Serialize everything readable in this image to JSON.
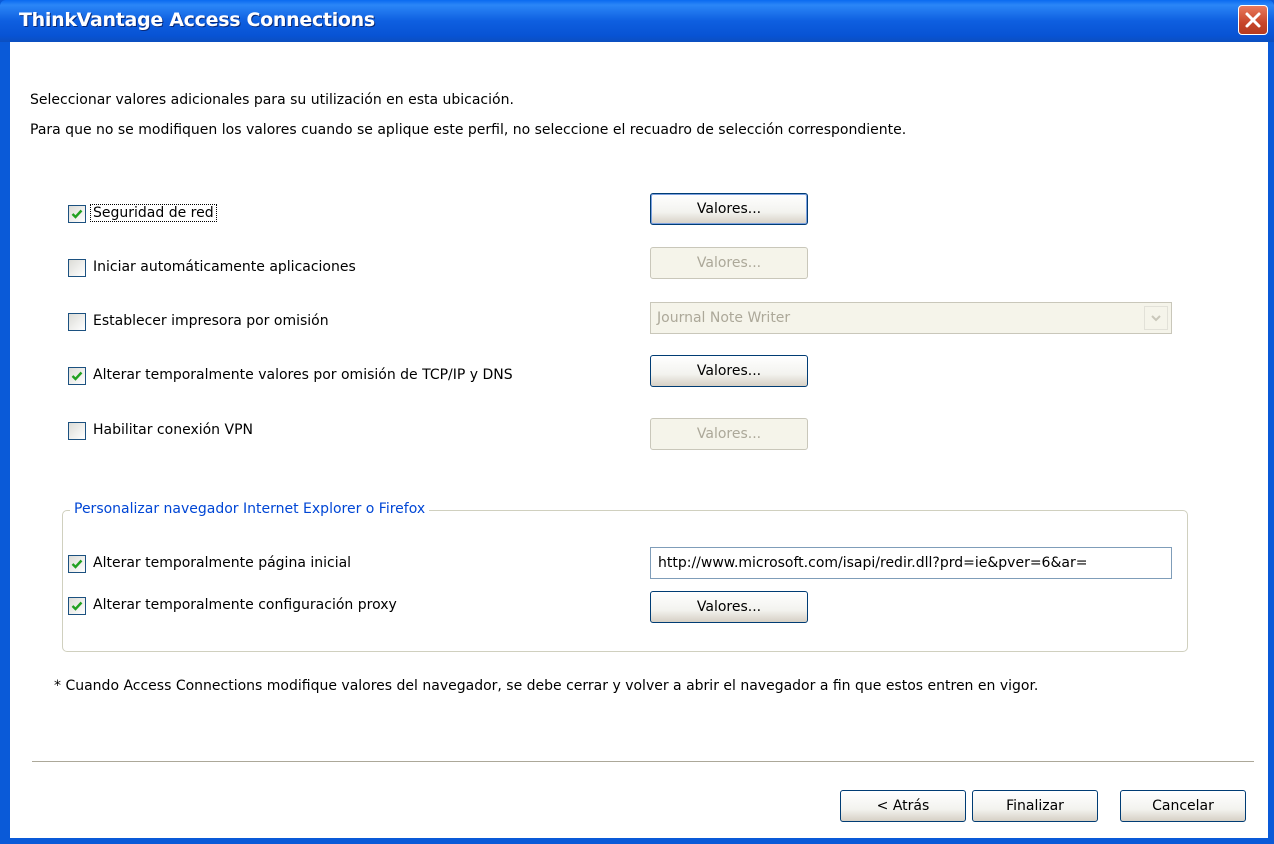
{
  "window": {
    "title": "ThinkVantage Access Connections"
  },
  "intro": {
    "line1": "Seleccionar valores adicionales para su utilización en esta ubicación.",
    "line2": "Para que no se modifiquen los valores cuando se aplique este perfil, no seleccione el recuadro de selección correspondiente."
  },
  "options": [
    {
      "label": "Seguridad de red",
      "checked": true,
      "button": "Valores...",
      "button_enabled": true
    },
    {
      "label": "Iniciar automáticamente aplicaciones",
      "checked": false,
      "button": "Valores...",
      "button_enabled": false
    },
    {
      "label": "Establecer impresora por omisión",
      "checked": false,
      "dropdown": "Journal Note Writer",
      "dropdown_enabled": false
    },
    {
      "label": "Alterar temporalmente valores por omisión de TCP/IP y DNS",
      "checked": true,
      "button": "Valores...",
      "button_enabled": true
    },
    {
      "label": "Habilitar conexión VPN",
      "checked": false,
      "button": "Valores...",
      "button_enabled": false
    }
  ],
  "browser_group": {
    "title": "Personalizar navegador Internet Explorer o Firefox",
    "home_page": {
      "label": "Alterar temporalmente página inicial",
      "checked": true,
      "value": "http://www.microsoft.com/isapi/redir.dll?prd=ie&pver=6&ar="
    },
    "proxy": {
      "label": "Alterar temporalmente configuración proxy",
      "checked": true,
      "button": "Valores..."
    }
  },
  "footnote": "* Cuando Access Connections modifique valores del navegador, se debe cerrar y volver a abrir el navegador a fin que estos entren en vigor.",
  "footer_buttons": {
    "back": "< Atrás",
    "finish": "Finalizar",
    "cancel": "Cancelar"
  },
  "colors": {
    "title_bar": "#0a5ad8",
    "group_title": "#0046d5",
    "checkmark": "#21a121",
    "close_button": "#c7462a"
  }
}
